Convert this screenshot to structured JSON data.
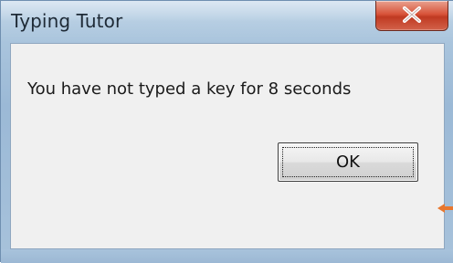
{
  "window": {
    "title": "Typing Tutor"
  },
  "dialog": {
    "message": "You have not typed a key for 8 seconds",
    "ok_label": "OK"
  },
  "icons": {
    "close": "close-icon",
    "pointer": "arrow-pointer-icon"
  },
  "colors": {
    "close_button": "#c94a30",
    "pointer_arrow": "#e8772e",
    "client_background": "#f0f0f0"
  }
}
